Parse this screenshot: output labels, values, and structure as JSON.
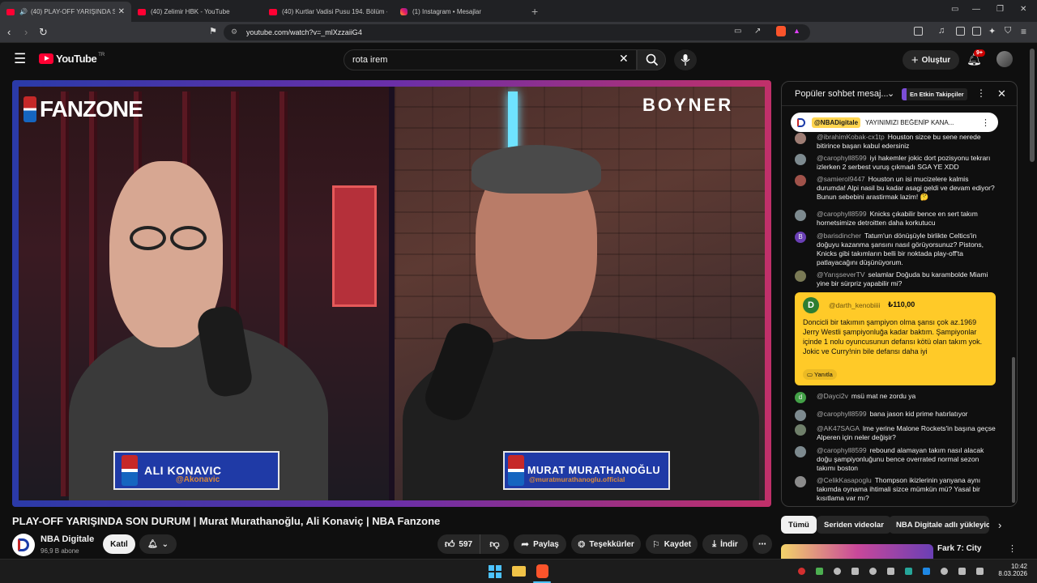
{
  "browser": {
    "tabs": [
      {
        "title": "(40) PLAY-OFF YARIŞINDA SO",
        "active": true,
        "type": "youtube"
      },
      {
        "title": "(40) Zelimir HBK - YouTube",
        "active": false,
        "type": "youtube"
      },
      {
        "title": "(40) Kurtlar Vadisi Pusu 194. Bölüm -",
        "active": false,
        "type": "youtube"
      },
      {
        "title": "(1) Instagram • Mesajlar",
        "active": false,
        "type": "instagram"
      }
    ],
    "url": "youtube.com/watch?v=_mlXzzaiiG4",
    "colors": {
      "accent": "#ff0033",
      "tab_bg": "#202124",
      "bar_bg": "#35363a"
    }
  },
  "header": {
    "logo_text": "YouTube",
    "logo_region": "TR",
    "search_value": "rota irem",
    "create_label": "Oluştur",
    "notif_count": "9+"
  },
  "video": {
    "overlay_left_logo": "FANZONE",
    "overlay_right_logo": "BOYNER",
    "left_name": "ALI KONAVIC",
    "left_handle": "@Akonavic",
    "right_name": "MURAT MURATHANOĞLU",
    "right_handle": "@muratmurathanoglu.official"
  },
  "meta": {
    "title": "PLAY-OFF YARIŞINDA SON DURUM | Murat Murathanoğlu, Ali Konaviç | NBA Fanzone",
    "channel": "NBA Digitale",
    "subscribers": "96,9 B abone",
    "join_label": "Katıl",
    "likes": "597",
    "share_label": "Paylaş",
    "thanks_label": "Teşekkürler",
    "save_label": "Kaydet",
    "download_label": "İndir"
  },
  "chat": {
    "title": "Popüler sohbet mesaj...",
    "badge": "En Etkin Takipçiler",
    "pinned_author": "@NBADigitale",
    "pinned_text": "YAYINIMIZI BEĞENİP KANA...",
    "messages": [
      {
        "author": "@ibrahimKobak-cx1tp",
        "text": "Houston sizce bu sene nerede bitirince başarı kabul edersiniz",
        "avatar": "#9e7d74"
      },
      {
        "author": "@carophyll8599",
        "text": "iyi hakemler jokic dort pozisyonu tekrarı izlerken 2 serbest vuruş çıkmadı SGA YE XDD",
        "avatar": "#7d8a8f"
      },
      {
        "author": "@samierol9447",
        "text": "Houston un isi mucizelere kalmis durumda! Alpi nasil bu kadar asagi geldi ve devam ediyor? Bunun sebebini arastirmak lazim! 🤔",
        "avatar": "#a0524a"
      },
      {
        "author": "@carophyll8599",
        "text": "Knicks çıkabilir bence en sert takım hornetsimize detroitten daha korkutucu",
        "avatar": "#7d8a8f"
      },
      {
        "author": "@barisdincher",
        "text": "Tatum'un dönüşüyle birlikte Celtics'in doğuyu kazanma şansını nasıl görüyorsunuz? Pistons, Knicks gibi takımların belli bir noktada play-off'ta patlayacağını düşünüyorum.",
        "avatar": "#6a3fb5",
        "initial": "B"
      },
      {
        "author": "@YarışseverTV",
        "text": "selamlar Doğuda bu karambolde Miami yine bir sürpriz yapabilir mi?",
        "avatar": "#7a7a55"
      }
    ],
    "superchat": {
      "initial": "D",
      "author": "@darth_kenobiiii",
      "amount": "₺110,00",
      "text": "Doncicli bir takımın şampiyon olma şansı çok az.1969 Jerry Westli şampiyonluğa kadar baktım. Şampiyonlar içinde 1 nolu oyuncusunun defansı kötü olan takım yok. Jokic ve Curry!nin bile defansı daha iyi",
      "reply_label": "Yanıtla"
    },
    "messages2": [
      {
        "author": "@Dayci2v",
        "text": "msü mat ne zordu ya",
        "avatar": "#43a047",
        "initial": "d"
      },
      {
        "author": "@carophyll8599",
        "text": "bana jason kid prime hatırlatıyor",
        "avatar": "#7d8a8f"
      },
      {
        "author": "@AK47SAGA",
        "text": "lme yerine Malone Rockets'in başına geçse Alperen için neler değişir?",
        "avatar": "#6f7f6a"
      },
      {
        "author": "@carophyll8599",
        "text": "rebound alamayan takım nasıl alacak doğu şampiyonluğunu bence overrated normal sezon takımı boston",
        "avatar": "#7d8a8f"
      },
      {
        "author": "@CelikKasapoglu",
        "text": "Thompson ikizlerinin yanyana aynı takımda oynama ihtimali sizce mümkün mü? Yasal bir kısıtlama var mı?",
        "avatar": "#8b8b8b"
      }
    ]
  },
  "filters": [
    "Tümü",
    "Seriden videolar",
    "NBA Digitale adlı yükleyici"
  ],
  "recommended": {
    "title": "Fark 7: City"
  },
  "taskbar": {
    "time": "10:42",
    "date": "8.03.2026"
  }
}
